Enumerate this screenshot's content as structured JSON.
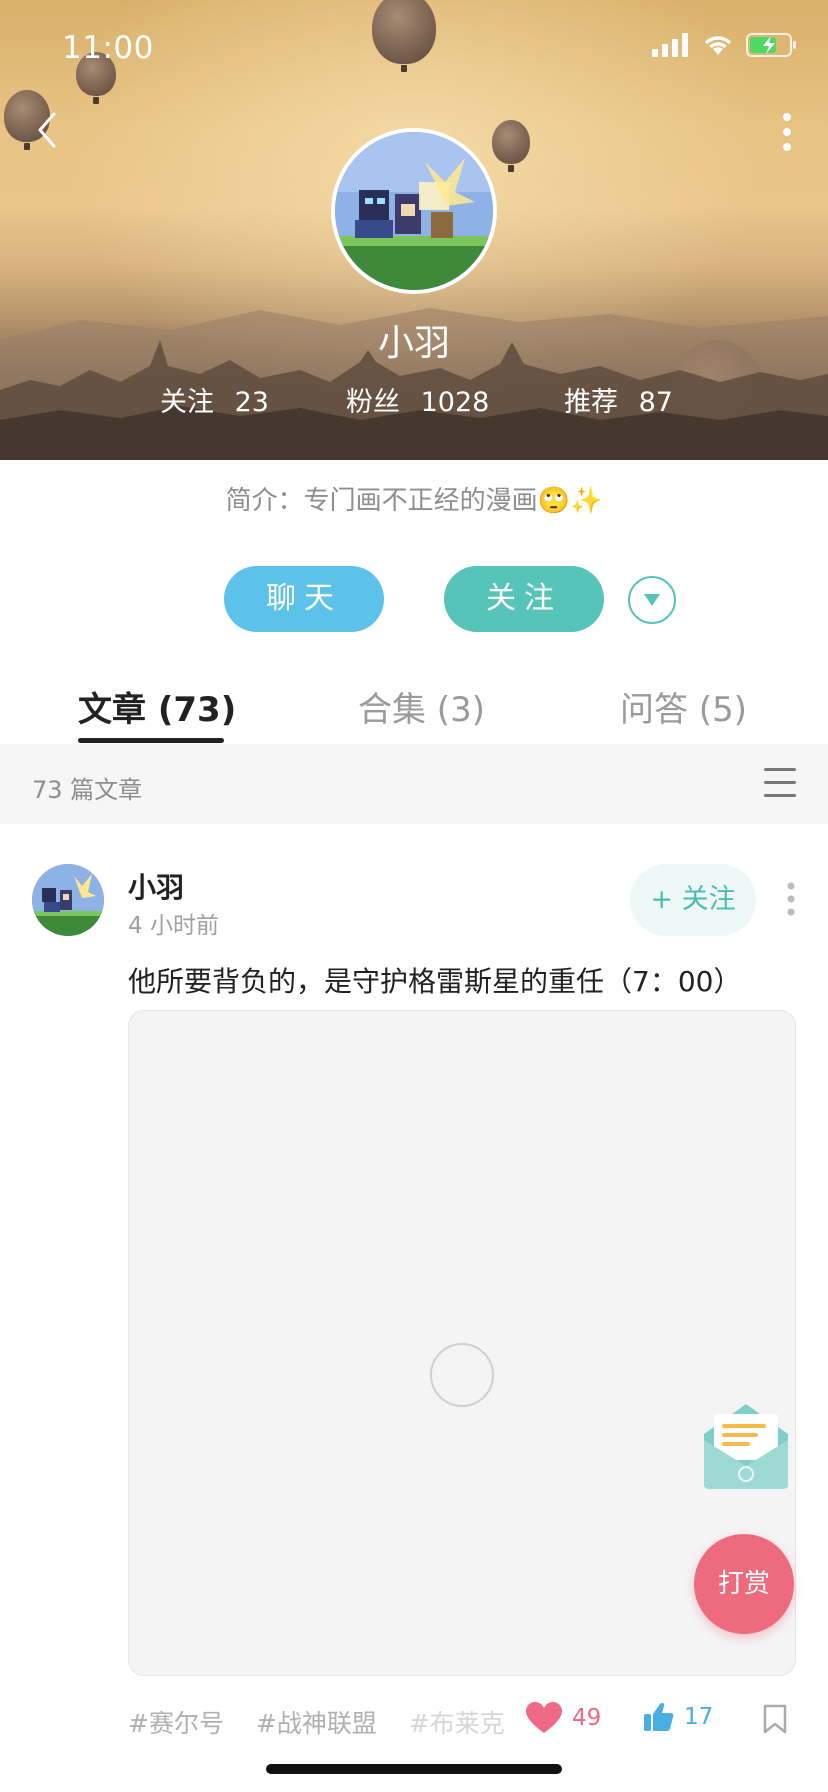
{
  "status_bar": {
    "time": "11:00"
  },
  "profile": {
    "nickname": "小羽",
    "stats": [
      {
        "label": "关注",
        "value": "23"
      },
      {
        "label": "粉丝",
        "value": "1028"
      },
      {
        "label": "推荐",
        "value": "87"
      }
    ],
    "bio": "简介：专门画不正经的漫画🙄✨"
  },
  "actions": {
    "chat_label": "聊天",
    "follow_label": "关注"
  },
  "tabs": [
    {
      "label": "文章 (73)",
      "active": true
    },
    {
      "label": "合集 (3)",
      "active": false
    },
    {
      "label": "问答 (5)",
      "active": false
    }
  ],
  "list_header": {
    "count_text": "73 篇文章"
  },
  "post": {
    "author": "小羽",
    "time": "4 小时前",
    "follow_label": "+ 关注",
    "title": "他所要背负的，是守护格雷斯星的重任（7：00）",
    "tags": [
      "#赛尔号",
      "#战神联盟",
      "#布莱克"
    ],
    "likes": "49",
    "thumbs_up": "17"
  },
  "floating": {
    "reward_label": "打赏"
  },
  "colors": {
    "chat_button": "#5cc2e9",
    "follow_button": "#56c4b8",
    "like": "#ee6a86",
    "thumb": "#4aaee0",
    "reward": "#ee6b7e"
  }
}
